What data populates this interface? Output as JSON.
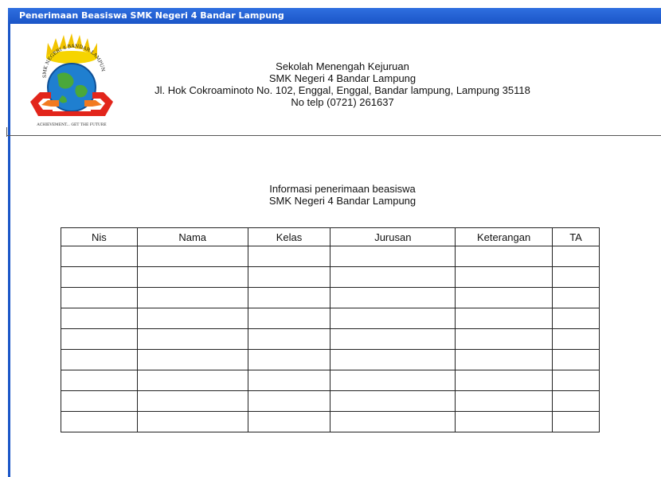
{
  "window": {
    "title": "Penerimaan Beasiswa SMK Negeri 4 Bandar Lampung"
  },
  "header": {
    "line1": "Sekolah Menengah Kejuruan",
    "line2": "SMK Negeri 4 Bandar Lampung",
    "line3": "Jl. Hok Cokroaminoto No. 102, Enggal, Enggal, Bandar lampung, Lampung 35118",
    "line4": "No telp (0721) 261637"
  },
  "logo": {
    "arc_text": "SMK NEGERI 4 BANDAR LAMPUNG",
    "tagline": "ACHIEVEMENT... GET THE FUTURE"
  },
  "info": {
    "line1": "Informasi penerimaan beasiswa",
    "line2": "SMK Negeri 4 Bandar Lampung"
  },
  "table": {
    "headers": [
      "Nis",
      "Nama",
      "Kelas",
      "Jurusan",
      "Keterangan",
      "TA"
    ],
    "rows": [
      [
        "",
        "",
        "",
        "",
        "",
        ""
      ],
      [
        "",
        "",
        "",
        "",
        "",
        ""
      ],
      [
        "",
        "",
        "",
        "",
        "",
        ""
      ],
      [
        "",
        "",
        "",
        "",
        "",
        ""
      ],
      [
        "",
        "",
        "",
        "",
        "",
        ""
      ],
      [
        "",
        "",
        "",
        "",
        "",
        ""
      ],
      [
        "",
        "",
        "",
        "",
        "",
        ""
      ],
      [
        "",
        "",
        "",
        "",
        "",
        ""
      ],
      [
        "",
        "",
        "",
        "",
        "",
        ""
      ]
    ]
  }
}
